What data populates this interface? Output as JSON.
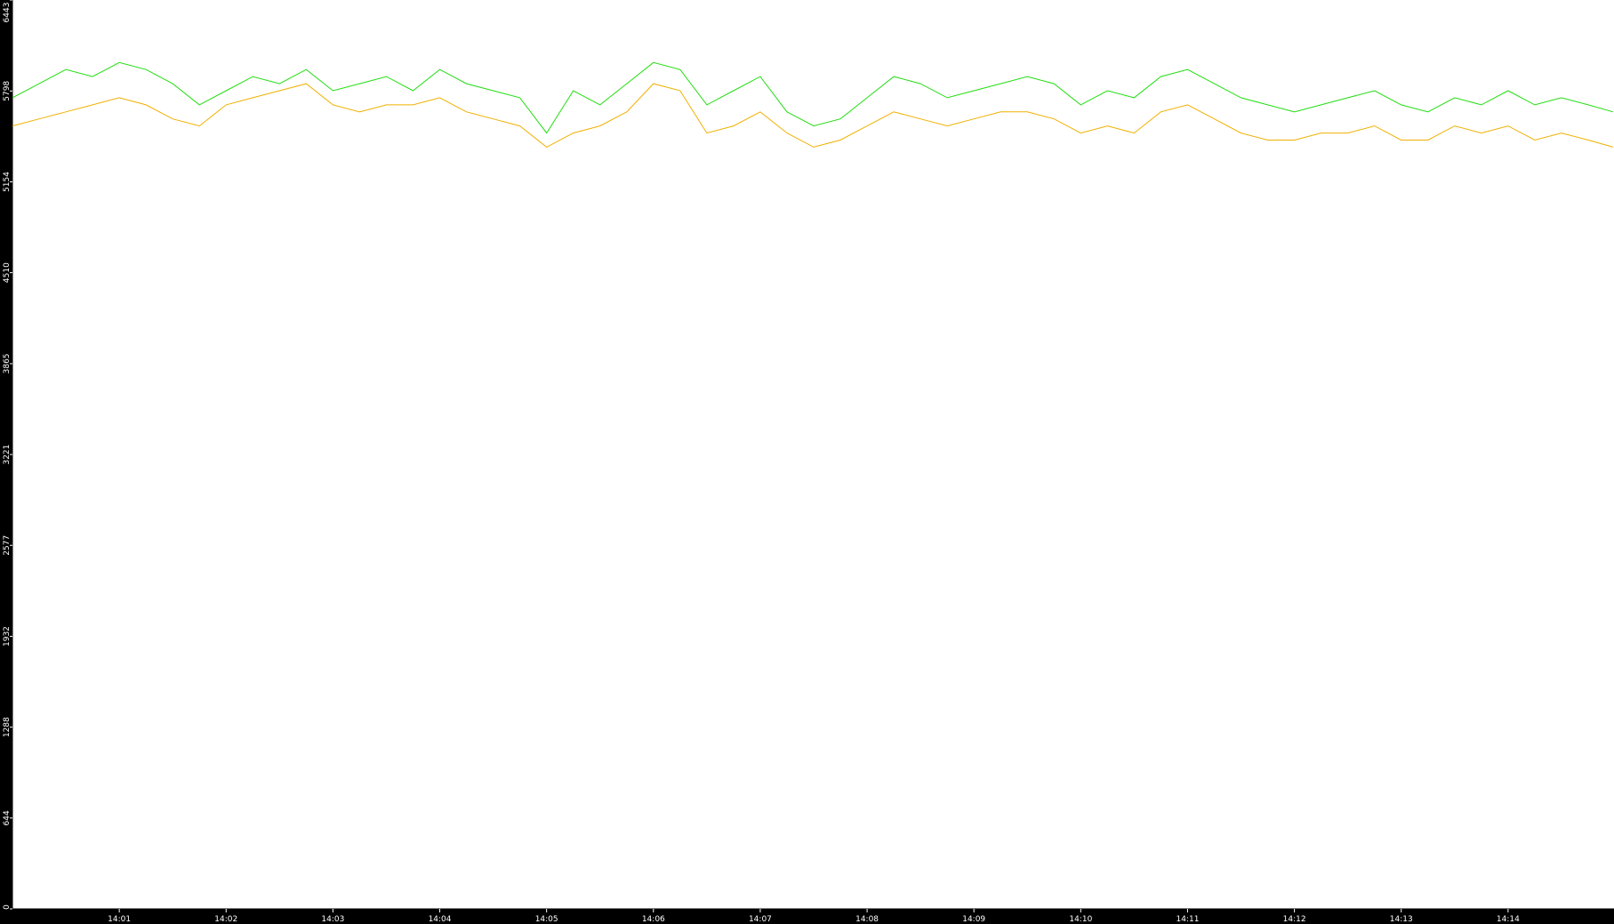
{
  "chart_data": {
    "type": "line",
    "title": "",
    "xlabel": "",
    "ylabel": "",
    "background": "#000000",
    "plot_background": "#ffffff",
    "grid": false,
    "legend": "none",
    "xlim": [
      "14:00:00",
      "14:14:59"
    ],
    "ylim": [
      0,
      6443
    ],
    "yticks": [
      0,
      644,
      1288,
      1932,
      2577,
      3221,
      3865,
      4510,
      5154,
      5798,
      6443
    ],
    "xticks": [
      "14:01",
      "14:02",
      "14:03",
      "14:04",
      "14:05",
      "14:06",
      "14:07",
      "14:08",
      "14:09",
      "14:10",
      "14:11",
      "14:12",
      "14:13",
      "14:14"
    ],
    "x": [
      "14:00:00",
      "14:00:15",
      "14:00:30",
      "14:00:45",
      "14:01:00",
      "14:01:15",
      "14:01:30",
      "14:01:45",
      "14:02:00",
      "14:02:15",
      "14:02:30",
      "14:02:45",
      "14:03:00",
      "14:03:15",
      "14:03:30",
      "14:03:45",
      "14:04:00",
      "14:04:15",
      "14:04:30",
      "14:04:45",
      "14:05:00",
      "14:05:15",
      "14:05:30",
      "14:05:45",
      "14:06:00",
      "14:06:15",
      "14:06:30",
      "14:06:45",
      "14:07:00",
      "14:07:15",
      "14:07:30",
      "14:07:45",
      "14:08:00",
      "14:08:15",
      "14:08:30",
      "14:08:45",
      "14:09:00",
      "14:09:15",
      "14:09:30",
      "14:09:45",
      "14:10:00",
      "14:10:15",
      "14:10:30",
      "14:10:45",
      "14:11:00",
      "14:11:15",
      "14:11:30",
      "14:11:45",
      "14:12:00",
      "14:12:15",
      "14:12:30",
      "14:12:45",
      "14:13:00",
      "14:13:15",
      "14:13:30",
      "14:13:45",
      "14:14:00",
      "14:14:15",
      "14:14:30",
      "14:14:45",
      "14:14:59"
    ],
    "series": [
      {
        "color": "#22dd11",
        "values": [
          5750,
          5850,
          5950,
          5900,
          6000,
          5950,
          5850,
          5700,
          5800,
          5900,
          5850,
          5950,
          5800,
          5850,
          5900,
          5800,
          5950,
          5850,
          5800,
          5750,
          5500,
          5800,
          5700,
          5850,
          6000,
          5950,
          5700,
          5800,
          5900,
          5650,
          5550,
          5600,
          5750,
          5900,
          5850,
          5750,
          5800,
          5850,
          5900,
          5850,
          5700,
          5800,
          5750,
          5900,
          5950,
          5850,
          5750,
          5700,
          5650,
          5700,
          5750,
          5800,
          5700,
          5650,
          5750,
          5700,
          5800,
          5700,
          5750,
          5700,
          5650
        ]
      },
      {
        "color": "#f0b000",
        "values": [
          5550,
          5600,
          5650,
          5700,
          5750,
          5700,
          5600,
          5550,
          5700,
          5750,
          5800,
          5850,
          5700,
          5650,
          5700,
          5700,
          5750,
          5650,
          5600,
          5550,
          5400,
          5500,
          5550,
          5650,
          5850,
          5800,
          5500,
          5550,
          5650,
          5500,
          5400,
          5450,
          5550,
          5650,
          5600,
          5550,
          5600,
          5650,
          5650,
          5600,
          5500,
          5550,
          5500,
          5650,
          5700,
          5600,
          5500,
          5450,
          5450,
          5500,
          5500,
          5550,
          5450,
          5450,
          5550,
          5500,
          5550,
          5450,
          5500,
          5450,
          5400
        ]
      }
    ]
  }
}
